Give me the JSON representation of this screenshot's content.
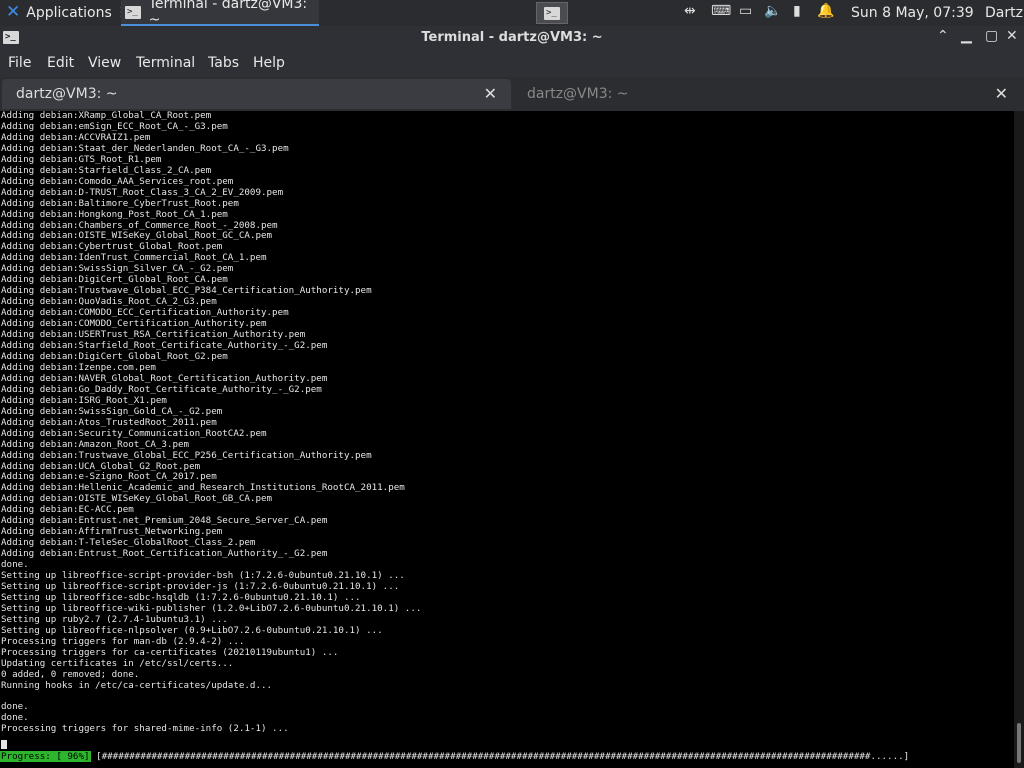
{
  "topbar": {
    "applications_label": "Applications",
    "taskbar_item": "Terminal - dartz@VM3: ~",
    "clock": "Sun  8 May, 07:39",
    "user": "Dartz"
  },
  "window": {
    "title": "Terminal - dartz@VM3: ~"
  },
  "menu": {
    "file": "File",
    "edit": "Edit",
    "view": "View",
    "terminal": "Terminal",
    "tabs": "Tabs",
    "help": "Help"
  },
  "tabs": [
    {
      "label": "dartz@VM3: ~",
      "active": true
    },
    {
      "label": "dartz@VM3: ~",
      "active": false
    }
  ],
  "terminal": {
    "lines": [
      "Adding debian:XRamp_Global_CA_Root.pem",
      "Adding debian:emSign_ECC_Root_CA_-_G3.pem",
      "Adding debian:ACCVRAIZ1.pem",
      "Adding debian:Staat_der_Nederlanden_Root_CA_-_G3.pem",
      "Adding debian:GTS_Root_R1.pem",
      "Adding debian:Starfield_Class_2_CA.pem",
      "Adding debian:Comodo_AAA_Services_root.pem",
      "Adding debian:D-TRUST_Root_Class_3_CA_2_EV_2009.pem",
      "Adding debian:Baltimore_CyberTrust_Root.pem",
      "Adding debian:Hongkong_Post_Root_CA_1.pem",
      "Adding debian:Chambers_of_Commerce_Root_-_2008.pem",
      "Adding debian:OISTE_WISeKey_Global_Root_GC_CA.pem",
      "Adding debian:Cybertrust_Global_Root.pem",
      "Adding debian:IdenTrust_Commercial_Root_CA_1.pem",
      "Adding debian:SwissSign_Silver_CA_-_G2.pem",
      "Adding debian:DigiCert_Global_Root_CA.pem",
      "Adding debian:Trustwave_Global_ECC_P384_Certification_Authority.pem",
      "Adding debian:QuoVadis_Root_CA_2_G3.pem",
      "Adding debian:COMODO_ECC_Certification_Authority.pem",
      "Adding debian:COMODO_Certification_Authority.pem",
      "Adding debian:USERTrust_RSA_Certification_Authority.pem",
      "Adding debian:Starfield_Root_Certificate_Authority_-_G2.pem",
      "Adding debian:DigiCert_Global_Root_G2.pem",
      "Adding debian:Izenpe.com.pem",
      "Adding debian:NAVER_Global_Root_Certification_Authority.pem",
      "Adding debian:Go_Daddy_Root_Certificate_Authority_-_G2.pem",
      "Adding debian:ISRG_Root_X1.pem",
      "Adding debian:SwissSign_Gold_CA_-_G2.pem",
      "Adding debian:Atos_TrustedRoot_2011.pem",
      "Adding debian:Security_Communication_RootCA2.pem",
      "Adding debian:Amazon_Root_CA_3.pem",
      "Adding debian:Trustwave_Global_ECC_P256_Certification_Authority.pem",
      "Adding debian:UCA_Global_G2_Root.pem",
      "Adding debian:e-Szigno_Root_CA_2017.pem",
      "Adding debian:Hellenic_Academic_and_Research_Institutions_RootCA_2011.pem",
      "Adding debian:OISTE_WISeKey_Global_Root_GB_CA.pem",
      "Adding debian:EC-ACC.pem",
      "Adding debian:Entrust.net_Premium_2048_Secure_Server_CA.pem",
      "Adding debian:AffirmTrust_Networking.pem",
      "Adding debian:T-TeleSec_GlobalRoot_Class_2.pem",
      "Adding debian:Entrust_Root_Certification_Authority_-_G2.pem",
      "done.",
      "Setting up libreoffice-script-provider-bsh (1:7.2.6-0ubuntu0.21.10.1) ...",
      "Setting up libreoffice-script-provider-js (1:7.2.6-0ubuntu0.21.10.1) ...",
      "Setting up libreoffice-sdbc-hsqldb (1:7.2.6-0ubuntu0.21.10.1) ...",
      "Setting up libreoffice-wiki-publisher (1.2.0+LibO7.2.6-0ubuntu0.21.10.1) ...",
      "Setting up ruby2.7 (2.7.4-1ubuntu3.1) ...",
      "Setting up libreoffice-nlpsolver (0.9+LibO7.2.6-0ubuntu0.21.10.1) ...",
      "Processing triggers for man-db (2.9.4-2) ...",
      "Processing triggers for ca-certificates (20210119ubuntu1) ...",
      "Updating certificates in /etc/ssl/certs...",
      "0 added, 0 removed; done.",
      "Running hooks in /etc/ca-certificates/update.d...",
      "",
      "done.",
      "done.",
      "Processing triggers for shared-mime-info (2.1-1) ..."
    ],
    "progress_label": "Progress: [ 96%]",
    "progress_bar": "[###########################################################################################################################################......]",
    "progress_percent": 96
  }
}
